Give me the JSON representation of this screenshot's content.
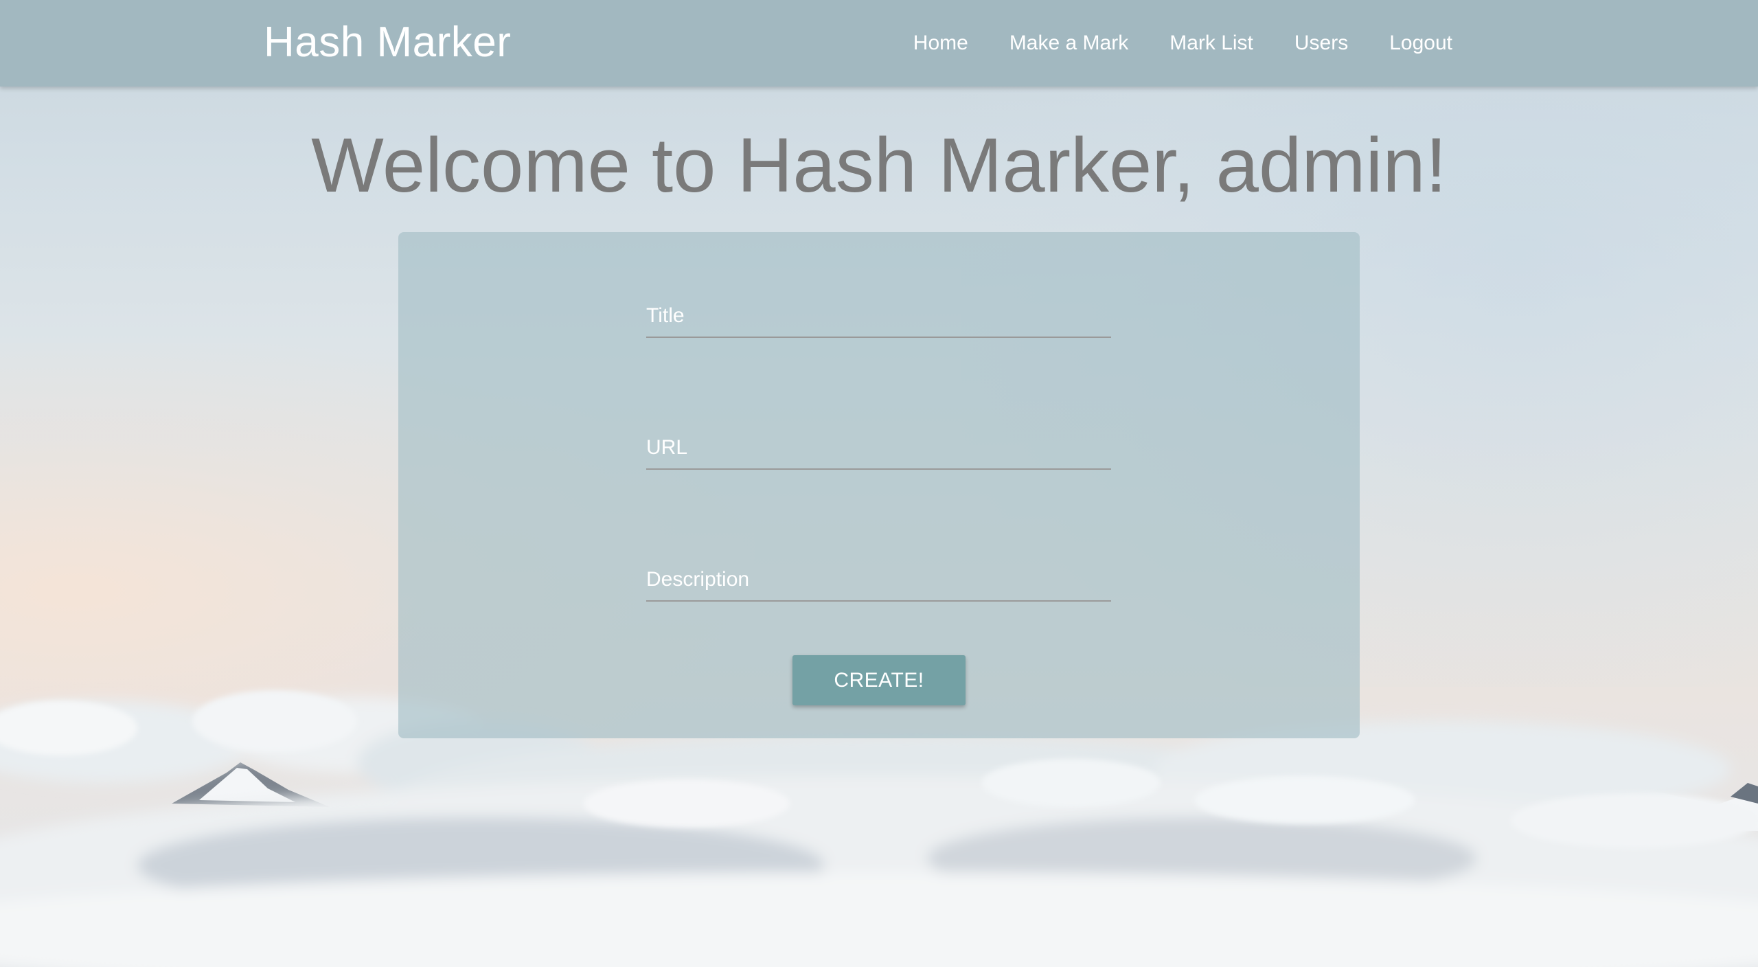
{
  "app": {
    "brand": "Hash Marker"
  },
  "nav": {
    "items": [
      {
        "label": "Home"
      },
      {
        "label": "Make a Mark"
      },
      {
        "label": "Mark List"
      },
      {
        "label": "Users"
      },
      {
        "label": "Logout"
      }
    ]
  },
  "main": {
    "heading": "Welcome to Hash Marker, admin!"
  },
  "form": {
    "title": {
      "placeholder": "Title",
      "value": ""
    },
    "url": {
      "placeholder": "URL",
      "value": ""
    },
    "description": {
      "placeholder": "Description",
      "value": ""
    },
    "submit_label": "CREATE!"
  },
  "colors": {
    "navbar": "#a2b8c0",
    "heading": "#7a7a7a",
    "button": "#74a1a5",
    "text_light": "#ffffff"
  }
}
